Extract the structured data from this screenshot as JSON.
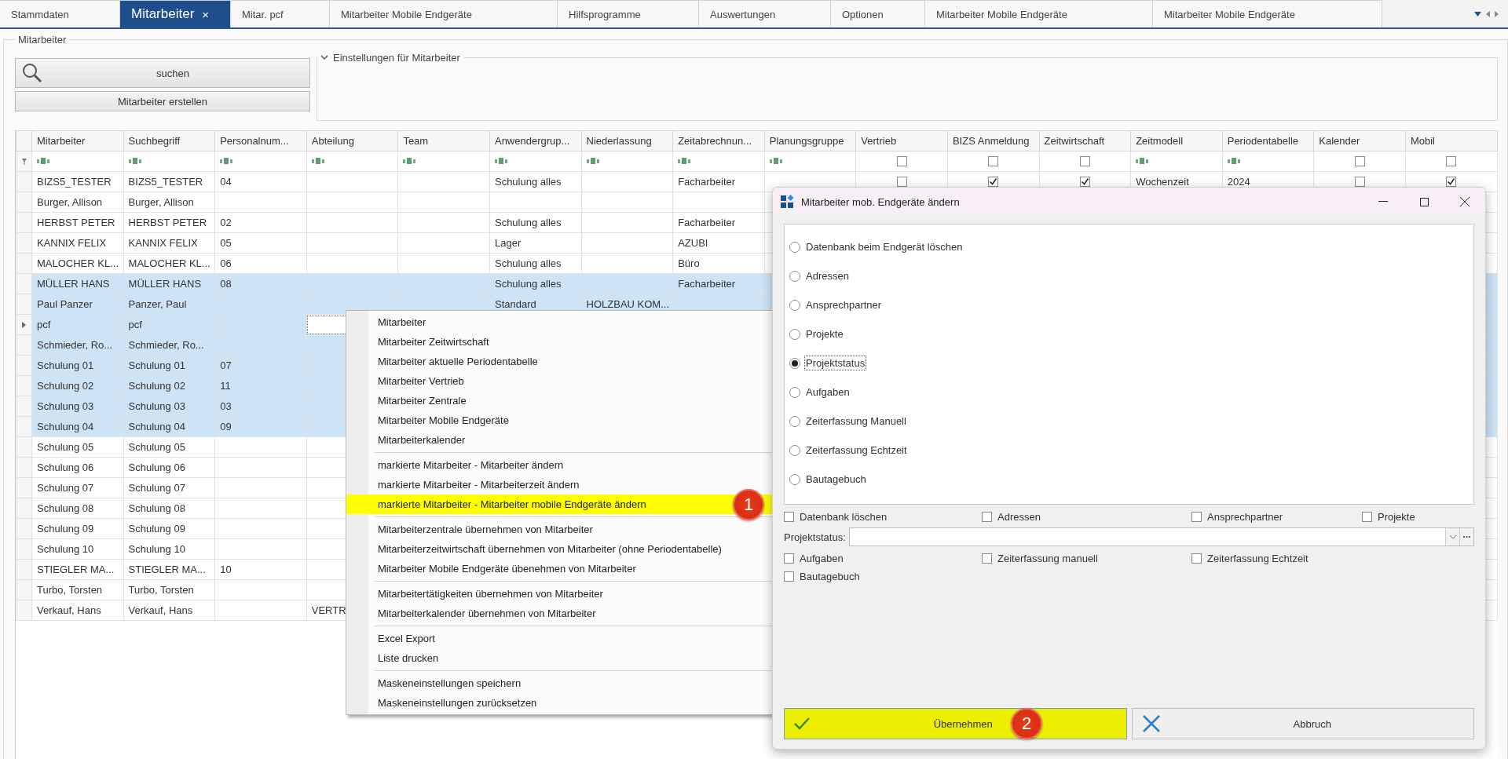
{
  "tabs": [
    {
      "label": "Stammdaten",
      "selected": false
    },
    {
      "label": "Mitarbeiter",
      "selected": true,
      "close": "×"
    },
    {
      "label": "Mitar. pcf",
      "selected": false
    },
    {
      "label": "Mitarbeiter Mobile Endgeräte",
      "selected": false
    },
    {
      "label": "Hilfsprogramme",
      "selected": false
    },
    {
      "label": "Auswertungen",
      "selected": false
    },
    {
      "label": "Optionen",
      "selected": false
    },
    {
      "label": "Mitarbeiter Mobile Endgeräte",
      "selected": false
    },
    {
      "label": "Mitarbeiter Mobile Endgeräte",
      "selected": false
    }
  ],
  "group_title": "Mitarbeiter",
  "search_button": "suchen",
  "create_button": "Mitarbeiter erstellen",
  "settings_panel": {
    "title": "Einstellungen für Mitarbeiter"
  },
  "table": {
    "columns": [
      {
        "label": "Mitarbeiter",
        "kind": "text"
      },
      {
        "label": "Suchbegriff",
        "kind": "text"
      },
      {
        "label": "Personalnum...",
        "kind": "text"
      },
      {
        "label": "Abteilung",
        "kind": "text"
      },
      {
        "label": "Team",
        "kind": "text"
      },
      {
        "label": "Anwendergrup...",
        "kind": "text"
      },
      {
        "label": "Niederlassung",
        "kind": "text"
      },
      {
        "label": "Zeitabrechnun...",
        "kind": "text"
      },
      {
        "label": "Planungsgruppe",
        "kind": "text"
      },
      {
        "label": "Vertrieb",
        "kind": "check",
        "filter_checked": false
      },
      {
        "label": "BIZS Anmeldung",
        "kind": "check",
        "filter_checked": false
      },
      {
        "label": "Zeitwirtschaft",
        "kind": "check",
        "filter_checked": false
      },
      {
        "label": "Zeitmodell",
        "kind": "text"
      },
      {
        "label": "Periodentabelle",
        "kind": "text"
      },
      {
        "label": "Kalender",
        "kind": "check",
        "filter_checked": false
      },
      {
        "label": "Mobil",
        "kind": "check",
        "filter_checked": false
      }
    ],
    "rows": [
      {
        "selected": false,
        "current": false,
        "mitarbeiter": "BIZS5_TESTER",
        "suchbegriff": "BIZS5_TESTER",
        "personalnummer": "04",
        "anwendergruppe": "Schulung alles",
        "zeitabrechnung": "Facharbeiter",
        "vertrieb": false,
        "bizs": true,
        "zeitwirtschaft": true,
        "zeitmodell": "Wochenzeit",
        "periodentabelle": "2024",
        "kalender": false,
        "mobil": true
      },
      {
        "selected": false,
        "current": false,
        "mitarbeiter": "Burger, Allison",
        "suchbegriff": "Burger, Allison"
      },
      {
        "selected": false,
        "current": false,
        "mitarbeiter": "HERBST PETER",
        "suchbegriff": "HERBST PETER",
        "personalnummer": "02",
        "anwendergruppe": "Schulung alles",
        "zeitabrechnung": "Facharbeiter"
      },
      {
        "selected": false,
        "current": false,
        "mitarbeiter": "KANNIX FELIX",
        "suchbegriff": "KANNIX FELIX",
        "personalnummer": "05",
        "anwendergruppe": "Lager",
        "zeitabrechnung": "AZUBI"
      },
      {
        "selected": false,
        "current": false,
        "mitarbeiter": "MALOCHER KL...",
        "suchbegriff": "MALOCHER KL...",
        "personalnummer": "06",
        "anwendergruppe": "Schulung alles",
        "zeitabrechnung": "Büro"
      },
      {
        "selected": true,
        "current": false,
        "mitarbeiter": "MÜLLER HANS",
        "suchbegriff": "MÜLLER HANS",
        "personalnummer": "08",
        "anwendergruppe": "Schulung alles",
        "zeitabrechnung": "Facharbeiter"
      },
      {
        "selected": true,
        "current": false,
        "mitarbeiter": "Paul Panzer",
        "suchbegriff": "Panzer, Paul",
        "anwendergruppe": "Standard",
        "niederlassung": "HOLZBAU KOM..."
      },
      {
        "selected": true,
        "current": true,
        "mitarbeiter": "pcf",
        "suchbegriff": "pcf"
      },
      {
        "selected": true,
        "current": false,
        "mitarbeiter": "Schmieder, Ro...",
        "suchbegriff": "Schmieder, Ro..."
      },
      {
        "selected": true,
        "current": false,
        "mitarbeiter": "Schulung 01",
        "suchbegriff": "Schulung 01",
        "personalnummer": "07"
      },
      {
        "selected": true,
        "current": false,
        "mitarbeiter": "Schulung 02",
        "suchbegriff": "Schulung 02",
        "personalnummer": "11"
      },
      {
        "selected": true,
        "current": false,
        "mitarbeiter": "Schulung 03",
        "suchbegriff": "Schulung 03",
        "personalnummer": "03"
      },
      {
        "selected": true,
        "current": false,
        "mitarbeiter": "Schulung 04",
        "suchbegriff": "Schulung 04",
        "personalnummer": "09"
      },
      {
        "selected": false,
        "current": false,
        "mitarbeiter": "Schulung 05",
        "suchbegriff": "Schulung 05"
      },
      {
        "selected": false,
        "current": false,
        "mitarbeiter": "Schulung 06",
        "suchbegriff": "Schulung 06"
      },
      {
        "selected": false,
        "current": false,
        "mitarbeiter": "Schulung 07",
        "suchbegriff": "Schulung 07"
      },
      {
        "selected": false,
        "current": false,
        "mitarbeiter": "Schulung 08",
        "suchbegriff": "Schulung 08"
      },
      {
        "selected": false,
        "current": false,
        "mitarbeiter": "Schulung 09",
        "suchbegriff": "Schulung 09"
      },
      {
        "selected": false,
        "current": false,
        "mitarbeiter": "Schulung 10",
        "suchbegriff": "Schulung 10"
      },
      {
        "selected": false,
        "current": false,
        "mitarbeiter": "STIEGLER MA...",
        "suchbegriff": "STIEGLER MA...",
        "personalnummer": "10"
      },
      {
        "selected": false,
        "current": false,
        "mitarbeiter": "Turbo, Torsten",
        "suchbegriff": "Turbo, Torsten"
      },
      {
        "selected": false,
        "current": false,
        "mitarbeiter": "Verkauf, Hans",
        "suchbegriff": "Verkauf, Hans",
        "abteilung": "VERTR"
      }
    ]
  },
  "context_menu": {
    "sections": [
      {
        "items": [
          {
            "label": "Mitarbeiter",
            "highlighted": false
          },
          {
            "label": "Mitarbeiter Zeitwirtschaft",
            "highlighted": false
          },
          {
            "label": "Mitarbeiter aktuelle Periodentabelle",
            "highlighted": false
          },
          {
            "label": "Mitarbeiter Vertrieb",
            "highlighted": false
          },
          {
            "label": "Mitarbeiter Zentrale",
            "highlighted": false
          },
          {
            "label": "Mitarbeiter Mobile Endgeräte",
            "highlighted": false
          },
          {
            "label": "Mitarbeiterkalender",
            "highlighted": false
          }
        ]
      },
      {
        "items": [
          {
            "label": "markierte Mitarbeiter - Mitarbeiter ändern",
            "highlighted": false
          },
          {
            "label": "markierte Mitarbeiter - Mitarbeiterzeit ändern",
            "highlighted": false
          },
          {
            "label": "markierte Mitarbeiter - Mitarbeiter mobile Endgeräte ändern",
            "highlighted": true,
            "badge": "1"
          }
        ]
      },
      {
        "items": [
          {
            "label": "Mitarbeiterzentrale übernehmen von Mitarbeiter",
            "highlighted": false
          },
          {
            "label": "Mitarbeiterzeitwirtschaft übernehmen von Mitarbeiter (ohne Periodentabelle)",
            "highlighted": false
          },
          {
            "label": "Mitarbeiter Mobile Endgeräte übenehmen von Mitarbeiter",
            "highlighted": false
          }
        ]
      },
      {
        "items": [
          {
            "label": "Mitarbeitertätigkeiten übernehmen von Mitarbeiter",
            "highlighted": false
          },
          {
            "label": "Mitarbeiterkalender übernehmen von Mitarbeiter",
            "highlighted": false
          }
        ]
      },
      {
        "items": [
          {
            "label": "Excel Export",
            "highlighted": false
          },
          {
            "label": "Liste drucken",
            "highlighted": false
          }
        ]
      },
      {
        "items": [
          {
            "label": "Maskeneinstellungen speichern",
            "highlighted": false
          },
          {
            "label": "Maskeneinstellungen zurücksetzen",
            "highlighted": false
          }
        ]
      }
    ]
  },
  "dialog": {
    "title": "Mitarbeiter mob. Endgeräte ändern",
    "radios": [
      {
        "label": "Datenbank beim Endgerät löschen",
        "selected": false
      },
      {
        "label": "Adressen",
        "selected": false
      },
      {
        "label": "Ansprechpartner",
        "selected": false
      },
      {
        "label": "Projekte",
        "selected": false
      },
      {
        "label": "Projektstatus",
        "selected": true
      },
      {
        "label": "Aufgaben",
        "selected": false
      },
      {
        "label": "Zeiterfassung Manuell",
        "selected": false
      },
      {
        "label": "Zeiterfassung Echtzeit",
        "selected": false
      },
      {
        "label": "Bautagebuch",
        "selected": false
      }
    ],
    "checks_top": [
      {
        "label": "Datenbank löschen",
        "checked": false
      },
      {
        "label": "Adressen",
        "checked": false
      },
      {
        "label": "Ansprechpartner",
        "checked": false
      },
      {
        "label": "Projekte",
        "checked": false
      }
    ],
    "status_field": {
      "label": "Projektstatus:"
    },
    "checks_bottom": [
      {
        "label": "Aufgaben",
        "checked": false
      },
      {
        "label": "Zeiterfassung manuell",
        "checked": false
      },
      {
        "label": "Zeiterfassung Echtzeit",
        "checked": false
      },
      {
        "label": "Bautagebuch",
        "checked": false
      }
    ],
    "ok_button": {
      "label": "Übernehmen",
      "highlighted": true,
      "badge": "2"
    },
    "cancel_button": {
      "label": "Abbruch"
    }
  }
}
